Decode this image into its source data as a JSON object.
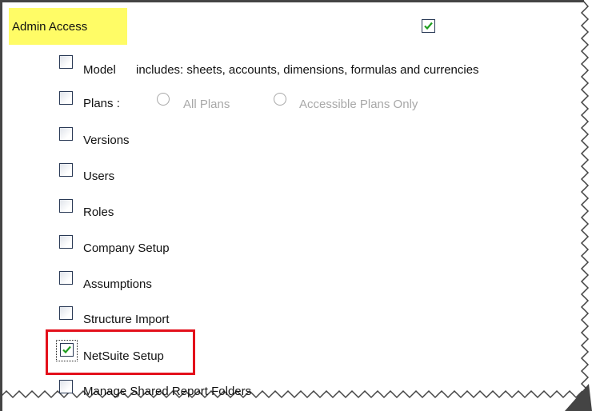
{
  "admin_access": {
    "label": "Admin Access",
    "checked": true
  },
  "items": [
    {
      "label": "Model",
      "note": "includes: sheets, accounts, dimensions, formulas and currencies",
      "checked": false
    },
    {
      "label": "Plans :",
      "checked": false,
      "radio_options": [
        "All Plans",
        "Accessible Plans Only"
      ]
    },
    {
      "label": "Versions",
      "checked": false
    },
    {
      "label": "Users",
      "checked": false
    },
    {
      "label": "Roles",
      "checked": false
    },
    {
      "label": "Company Setup",
      "checked": false
    },
    {
      "label": "Assumptions",
      "checked": false
    },
    {
      "label": "Structure Import",
      "checked": false
    },
    {
      "label": "NetSuite Setup",
      "checked": true,
      "highlighted": true
    },
    {
      "label": "Manage Shared Report Folders",
      "checked": false
    }
  ],
  "colors": {
    "header_highlight": "#fffc66",
    "highlight_border": "#e3101b",
    "check_mark": "#1f9d1f",
    "disabled_text": "#a8a8a8"
  },
  "icons": {
    "checkbox": "checkbox-icon",
    "check": "check-mark-icon",
    "radio": "radio-icon"
  }
}
